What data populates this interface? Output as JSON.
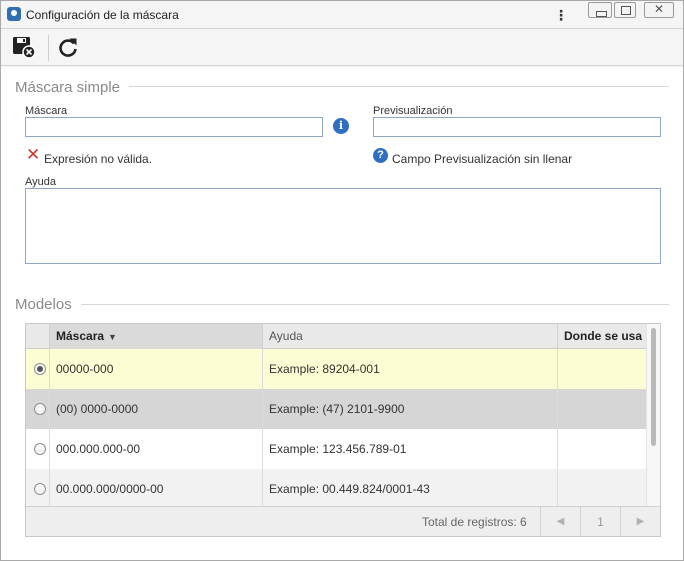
{
  "window": {
    "title": "Configuración de la máscara",
    "icons": [
      "app-icon",
      "more-vert-icon",
      "minimize-icon",
      "maximize-icon",
      "close-icon"
    ],
    "more_glyph": "⋮",
    "close_glyph": "✕"
  },
  "toolbar": {
    "icons": [
      "save-close-icon",
      "refresh-icon"
    ]
  },
  "simple": {
    "section_title": "Máscara simple",
    "mask_label": "Máscara",
    "mask_value": "",
    "preview_label": "Previsualización",
    "preview_value": "",
    "info_glyph": "i",
    "error_glyph": "✕",
    "error_message": "Expresión no válida.",
    "help_glyph": "?",
    "preview_message": "Campo Previsualización sin llenar",
    "help_label": "Ayuda",
    "help_value": ""
  },
  "models": {
    "section_title": "Modelos",
    "columns": [
      "Máscara",
      "Ayuda",
      "Donde se usa"
    ],
    "sort_glyph": "▼",
    "rows": [
      {
        "mask": "00000-000",
        "help": "Example: 89204-001",
        "where": "",
        "selected": true
      },
      {
        "mask": "(00) 0000-0000",
        "help": "Example: (47) 2101-9900",
        "where": "",
        "selected": false
      },
      {
        "mask": "000.000.000-00",
        "help": "Example: 123.456.789-01",
        "where": "",
        "selected": false
      },
      {
        "mask": "00.000.000/0000-00",
        "help": "Example: 00.449.824/0001-43",
        "where": "",
        "selected": false
      }
    ],
    "total_label": "Total de registros: 6",
    "page": "1",
    "prev_glyph": "◀",
    "next_glyph": "▶"
  },
  "colors": {
    "accent": "#2e6fc4",
    "error": "#d0342c",
    "selected_row": "#fdfdd3",
    "hover_row": "#d6d6d6"
  }
}
